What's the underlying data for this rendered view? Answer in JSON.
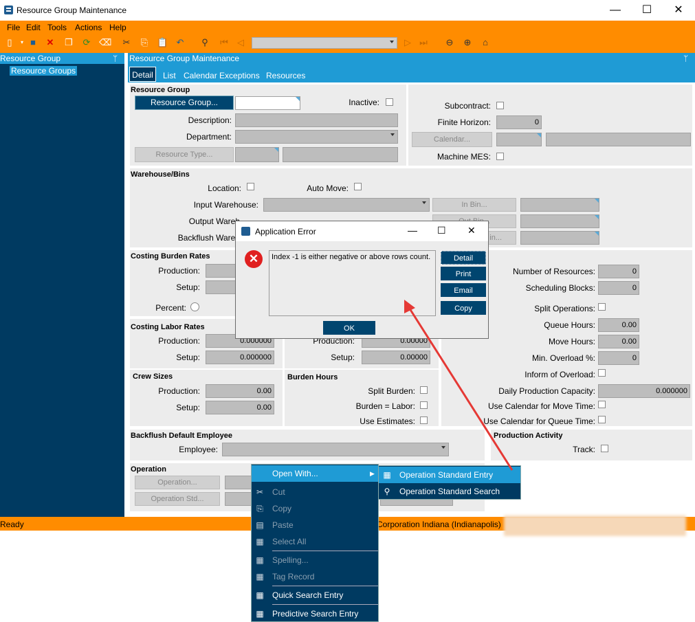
{
  "window": {
    "title": "Resource Group Maintenance",
    "minimize": "—",
    "maximize": "☐",
    "close": "✕"
  },
  "menu": [
    "File",
    "Edit",
    "Tools",
    "Actions",
    "Help"
  ],
  "tree": {
    "header": "Resource Group",
    "pin": "ᛘ",
    "item": "Resource Groups"
  },
  "main": {
    "header": "Resource Group Maintenance",
    "pin": "ᛘ",
    "tabs": [
      "Detail",
      "List",
      "Calendar Exceptions",
      "Resources"
    ]
  },
  "resource_group": {
    "title": "Resource Group",
    "btn": "Resource Group...",
    "inactive": "Inactive:",
    "description": "Description:",
    "department": "Department:",
    "resource_type_btn": "Resource Type..."
  },
  "right_top": {
    "subcontract": "Subcontract:",
    "finite_horizon": "Finite Horizon:",
    "finite_horizon_value": "0",
    "calendar_btn": "Calendar...",
    "machine_mes": "Machine MES:"
  },
  "warehouse": {
    "title": "Warehouse/Bins",
    "location": "Location:",
    "auto_move": "Auto Move:",
    "input_wh": "Input Warehouse:",
    "output_wh": "Output Wareh",
    "backflush_wh": "Backflush Wareh",
    "in_bin": "In Bin...",
    "out_bin": "Out Bin...",
    "bf_bin": "in..."
  },
  "costing_burden": {
    "title": "Costing Burden Rates",
    "production": "Production:",
    "setup": "Setup:",
    "percent": "Percent:"
  },
  "costing_labor": {
    "title": "Costing Labor Rates",
    "production": "Production:",
    "setup": "Setup:",
    "prod_value": "0.000000",
    "setup_value": "0.000000",
    "prod2": "Production:",
    "setup2": "Setup:",
    "prod2_value": "0.00000",
    "setup2_value": "0.00000"
  },
  "crew": {
    "title": "Crew Sizes",
    "production": "Production:",
    "setup": "Setup:",
    "prod_value": "0.00",
    "setup_value": "0.00"
  },
  "burden_hours": {
    "title": "Burden Hours",
    "split": "Split Burden:",
    "burden_labor": "Burden = Labor:",
    "estimates": "Use Estimates:"
  },
  "right_mid": {
    "num_resources": "Number of Resources:",
    "num_resources_value": "0",
    "sched_blocks": "Scheduling Blocks:",
    "sched_blocks_value": "0",
    "split_ops": "Split Operations:",
    "queue_hours": "Queue Hours:",
    "queue_hours_value": "0.00",
    "move_hours": "Move Hours:",
    "move_hours_value": "0.00",
    "min_overload": "Min. Overload %:",
    "min_overload_value": "0",
    "inform_overload": "Inform of Overload:",
    "daily_capacity": "Daily Production Capacity:",
    "daily_capacity_value": "0.000000",
    "cal_move": "Use Calendar for Move Time:",
    "cal_queue": "Use Calendar for Queue Time:"
  },
  "backflush_emp": {
    "title": "Backflush Default Employee",
    "employee": "Employee:"
  },
  "production_activity": {
    "title": "Production Activity",
    "track": "Track:"
  },
  "operation": {
    "title": "Operation",
    "op_btn": "Operation...",
    "op_std_btn": "Operation Std..."
  },
  "status": {
    "left": "Ready",
    "right": "d Corporation  Indiana (Indianapolis)"
  },
  "dialog": {
    "title": "Application Error",
    "message": "Index -1 is either negative or above rows count.",
    "buttons": [
      "Detail",
      "Print",
      "Email",
      "Copy"
    ],
    "ok": "OK"
  },
  "context_menu": {
    "items": [
      "Open With...",
      "Cut",
      "Copy",
      "Paste",
      "Select All",
      "Spelling...",
      "Tag Record",
      "Quick Search Entry",
      "Predictive Search Entry"
    ],
    "submenu": [
      "Operation Standard Entry",
      "Operation Standard Search"
    ]
  },
  "colors": {
    "accent_orange": "#ff8c00",
    "accent_blue": "#1f9bd5",
    "dark_navy": "#003a61",
    "arrow_red": "#e53935"
  }
}
